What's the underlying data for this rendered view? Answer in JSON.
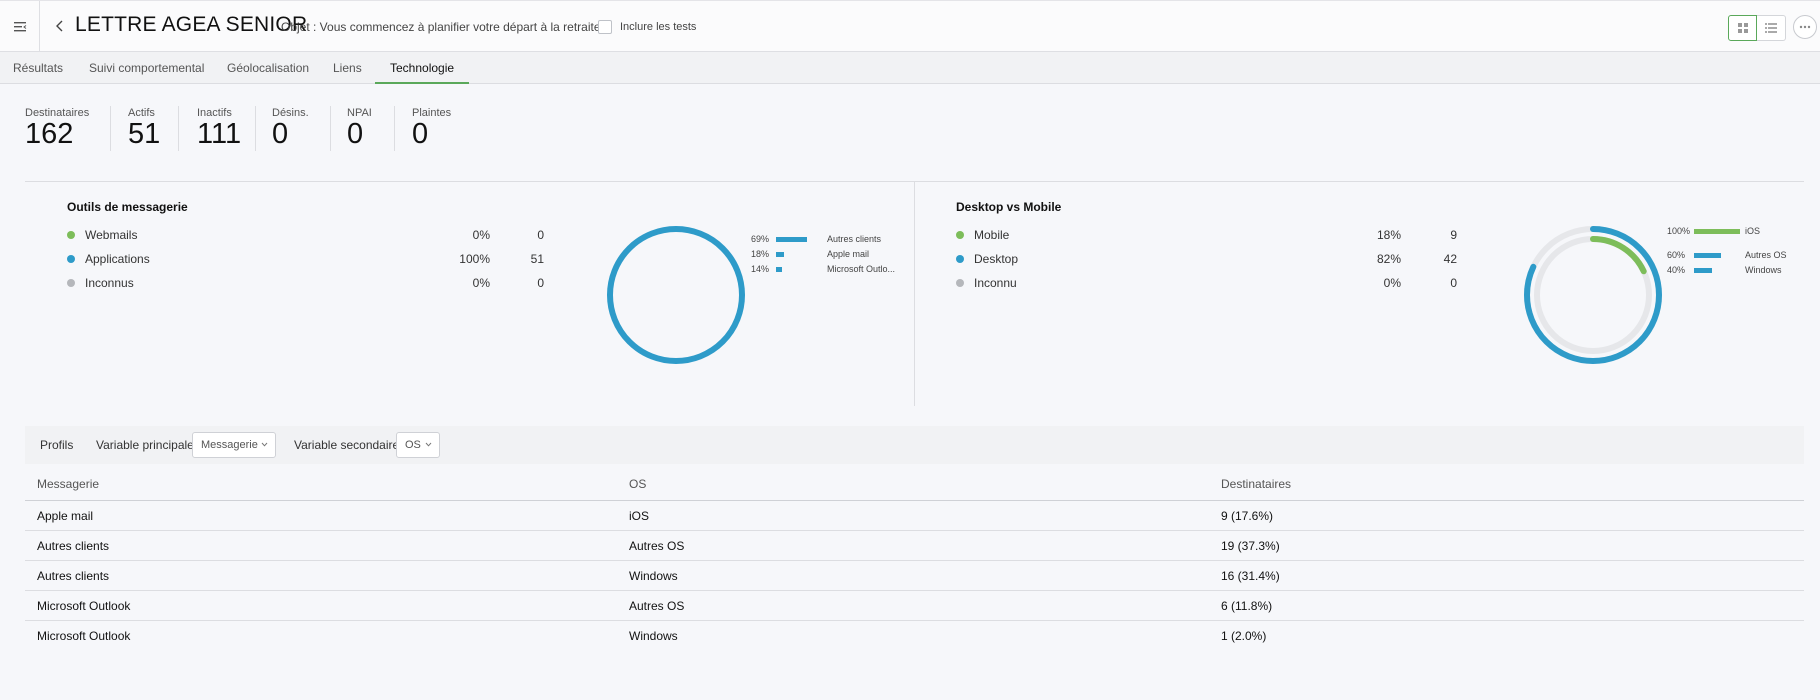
{
  "header": {
    "title": "LETTRE AGEA SENIOR",
    "subject": "Objet : Vous commencez à planifier votre départ à la retraite ?",
    "include_tests_label": "Inclure les tests"
  },
  "tabs": [
    {
      "label": "Résultats",
      "active": false
    },
    {
      "label": "Suivi comportemental",
      "active": false
    },
    {
      "label": "Géolocalisation",
      "active": false
    },
    {
      "label": "Liens",
      "active": false
    },
    {
      "label": "Technologie",
      "active": true
    }
  ],
  "stats": [
    {
      "label": "Destinataires",
      "value": "162"
    },
    {
      "label": "Actifs",
      "value": "51"
    },
    {
      "label": "Inactifs",
      "value": "111"
    },
    {
      "label": "Désins.",
      "value": "0"
    },
    {
      "label": "NPAI",
      "value": "0"
    },
    {
      "label": "Plaintes",
      "value": "0"
    }
  ],
  "messaging_panel": {
    "title": "Outils de messagerie",
    "rows": [
      {
        "name": "Webmails",
        "pct": "0%",
        "count": "0",
        "color": "#7dbd5a"
      },
      {
        "name": "Applications",
        "pct": "100%",
        "count": "51",
        "color": "#2e9bc9"
      },
      {
        "name": "Inconnus",
        "pct": "0%",
        "count": "0",
        "color": "#b5b7bb"
      }
    ],
    "clients": [
      {
        "pct": "69%",
        "name": "Autres clients",
        "fraction": 0.69
      },
      {
        "pct": "18%",
        "name": "Apple mail",
        "fraction": 0.18
      },
      {
        "pct": "14%",
        "name": "Microsoft Outlo...",
        "fraction": 0.14
      }
    ]
  },
  "device_panel": {
    "title": "Desktop vs Mobile",
    "rows": [
      {
        "name": "Mobile",
        "pct": "18%",
        "count": "9",
        "color": "#7dbd5a"
      },
      {
        "name": "Desktop",
        "pct": "82%",
        "count": "42",
        "color": "#2e9bc9"
      },
      {
        "name": "Inconnu",
        "pct": "0%",
        "count": "0",
        "color": "#b5b7bb"
      }
    ],
    "os": [
      {
        "pct": "100%",
        "name": "iOS",
        "fraction": 1.0,
        "color": "#7dbd5a"
      },
      {
        "pct": "60%",
        "name": "Autres OS",
        "fraction": 0.6,
        "color": "#2e9bc9"
      },
      {
        "pct": "40%",
        "name": "Windows",
        "fraction": 0.4,
        "color": "#2e9bc9"
      }
    ]
  },
  "profiles": {
    "label": "Profils",
    "primary_label": "Variable principale",
    "primary_value": "Messagerie",
    "secondary_label": "Variable secondaire",
    "secondary_value": "OS"
  },
  "table": {
    "columns": [
      "Messagerie",
      "OS",
      "Destinataires"
    ],
    "rows": [
      [
        "Apple mail",
        "iOS",
        "9 (17.6%)"
      ],
      [
        "Autres clients",
        "Autres OS",
        "19 (37.3%)"
      ],
      [
        "Autres clients",
        "Windows",
        "16 (31.4%)"
      ],
      [
        "Microsoft Outlook",
        "Autres OS",
        "6 (11.8%)"
      ],
      [
        "Microsoft Outlook",
        "Windows",
        "1 (2.0%)"
      ]
    ]
  },
  "colors": {
    "accent_green": "#5aa85a",
    "blue": "#2e9bc9",
    "green": "#7dbd5a",
    "grey": "#b5b7bb"
  }
}
